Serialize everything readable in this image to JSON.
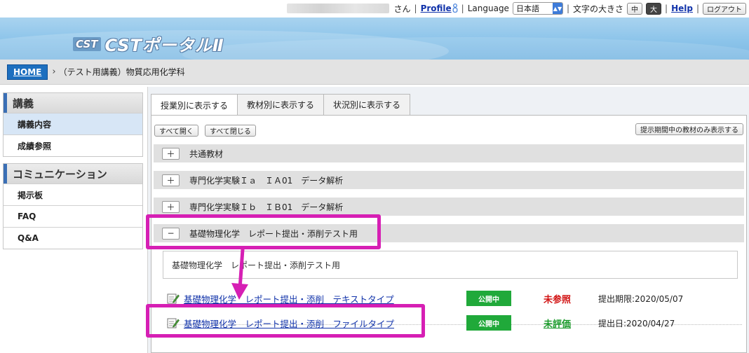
{
  "topbar": {
    "san": "さん",
    "profile": "Profile",
    "language_label": "Language",
    "language_value": "日本語",
    "font_size_label": "文字の大きさ",
    "font_medium": "中",
    "font_large": "大",
    "help": "Help",
    "logout": "ログアウト"
  },
  "banner": {
    "mark": "CST",
    "title": "CSTポータルⅡ"
  },
  "breadcrumb": {
    "home": "HOME",
    "current": "（テスト用講義）物質応用化学科"
  },
  "sidebar": {
    "groups": [
      {
        "title": "講義",
        "items": [
          {
            "label": "講義内容",
            "active": true
          },
          {
            "label": "成績参照"
          }
        ]
      },
      {
        "title": "コミュニケーション",
        "items": [
          {
            "label": "掲示板"
          },
          {
            "label": "FAQ"
          },
          {
            "label": "Q&A"
          }
        ]
      }
    ]
  },
  "tabs": [
    {
      "label": "授業別に表示する",
      "active": true
    },
    {
      "label": "教材別に表示する"
    },
    {
      "label": "状況別に表示する"
    }
  ],
  "panel": {
    "expand_all": "すべて開く",
    "collapse_all": "すべて閉じる",
    "show_active_only": "提示期間中の教材のみ表示する",
    "sections": [
      {
        "toggle": "＋",
        "title": "共通教材"
      },
      {
        "toggle": "＋",
        "title": "専門化学実験Ｉａ　ＩＡ01　データ解析"
      },
      {
        "toggle": "＋",
        "title": "専門化学実験Ｉｂ　ＩＢ01　データ解析"
      },
      {
        "toggle": "−",
        "title": "基礎物理化学　レポート提出・添削テスト用"
      }
    ],
    "description": "基礎物理化学　レポート提出・添削テスト用",
    "materials": [
      {
        "title": "基礎物理化学　レポート提出・添削　テキストタイプ",
        "badge": "公開中",
        "status": "未参照",
        "deadline": "提出期限:2020/05/07"
      },
      {
        "title": "基礎物理化学　レポート提出・添削　ファイルタイプ",
        "badge": "公開中",
        "status": "未評価",
        "deadline": "提出日:2020/04/27"
      }
    ]
  },
  "colors": {
    "highlight": "#d61fb4",
    "badge": "#20a93a",
    "status_red": "#d21414",
    "status_green": "#1a9a2a",
    "link": "#1133aa"
  }
}
